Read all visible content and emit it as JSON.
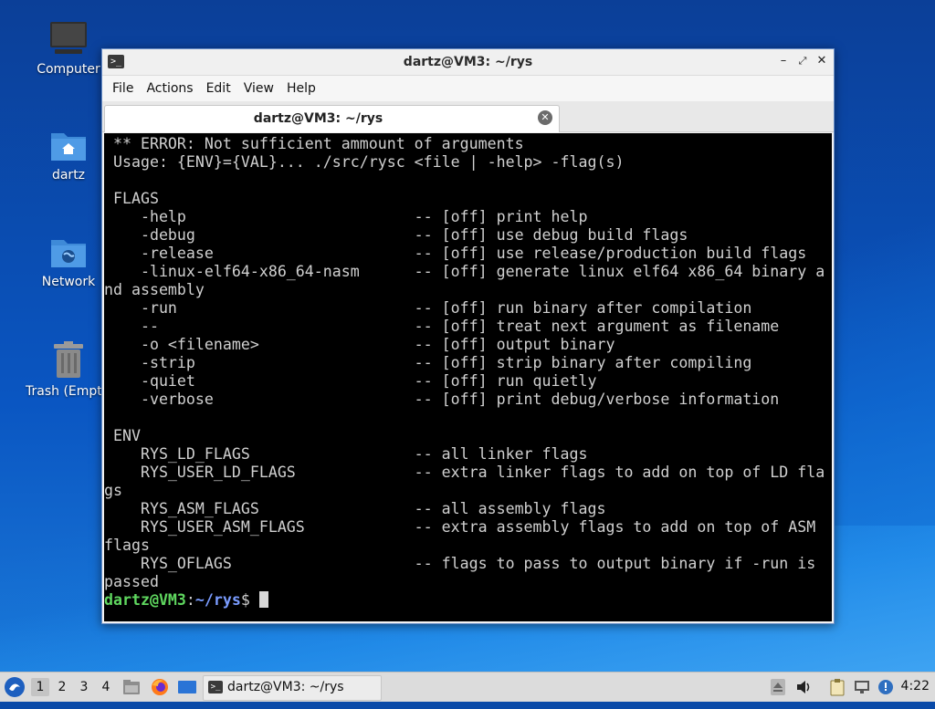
{
  "desktop": {
    "icons": [
      {
        "label": "Computer",
        "icon": "computer-icon"
      },
      {
        "label": "dartz",
        "icon": "home-folder-icon"
      },
      {
        "label": "Network",
        "icon": "network-folder-icon"
      },
      {
        "label": "Trash (Empt",
        "icon": "trash-icon"
      }
    ]
  },
  "window": {
    "title": "dartz@VM3: ~/rys",
    "menu": [
      "File",
      "Actions",
      "Edit",
      "View",
      "Help"
    ],
    "tab": {
      "label": "dartz@VM3: ~/rys"
    }
  },
  "terminal": {
    "lines": [
      " ** ERROR: Not sufficient ammount of arguments",
      " Usage: {ENV}={VAL}... ./src/rysc <file | -help> -flag(s)",
      "",
      " FLAGS",
      "    -help                         -- [off] print help",
      "    -debug                        -- [off] use debug build flags",
      "    -release                      -- [off] use release/production build flags",
      "    -linux-elf64-x86_64-nasm      -- [off] generate linux elf64 x86_64 binary a",
      "nd assembly",
      "    -run                          -- [off] run binary after compilation",
      "    --                            -- [off] treat next argument as filename",
      "    -o <filename>                 -- [off] output binary",
      "    -strip                        -- [off] strip binary after compiling",
      "    -quiet                        -- [off] run quietly",
      "    -verbose                      -- [off] print debug/verbose information",
      "",
      " ENV",
      "    RYS_LD_FLAGS                  -- all linker flags",
      "    RYS_USER_LD_FLAGS             -- extra linker flags to add on top of LD fla",
      "gs",
      "    RYS_ASM_FLAGS                 -- all assembly flags",
      "    RYS_USER_ASM_FLAGS            -- extra assembly flags to add on top of ASM",
      "flags",
      "    RYS_OFLAGS                    -- flags to pass to output binary if -run is",
      "passed"
    ],
    "prompt_user": "dartz@VM3",
    "prompt_sep": ":",
    "prompt_path": "~/rys",
    "prompt_symbol": "$ "
  },
  "taskbar": {
    "workspaces": [
      "1",
      "2",
      "3",
      "4"
    ],
    "active_workspace": "1",
    "task_label": "dartz@VM3: ~/rys",
    "clock": "4:22"
  }
}
